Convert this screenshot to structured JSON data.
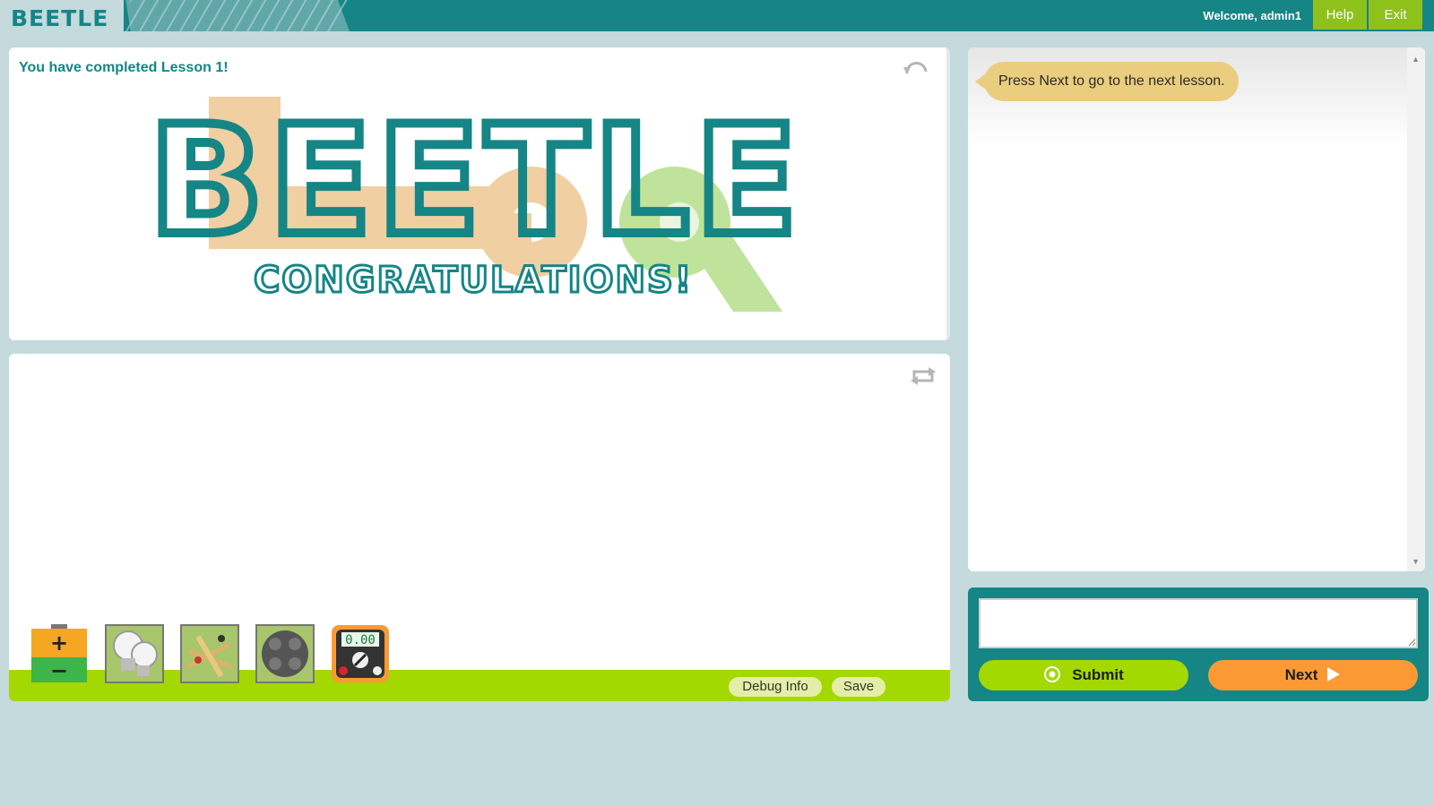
{
  "header": {
    "logo": "BEETLE",
    "welcome": "Welcome, admin1",
    "help_label": "Help",
    "exit_label": "Exit"
  },
  "lesson": {
    "title": "You have completed Lesson 1!",
    "art_logo": "BEETLE",
    "art_caption": "CONGRATULATIONS!"
  },
  "workspace": {
    "meter_reading": "0.00",
    "battery_plus": "+",
    "battery_minus": "−",
    "debug_label": "Debug Info",
    "save_label": "Save",
    "tools": [
      "battery-tool",
      "bulb-tool",
      "wire-tool",
      "switch-tool",
      "multimeter-tool"
    ]
  },
  "chat": {
    "messages": [
      {
        "text": "Press Next to go to the next lesson."
      }
    ]
  },
  "input": {
    "value": "",
    "submit_label": "Submit",
    "next_label": "Next"
  },
  "colors": {
    "brand_teal": "#158586",
    "accent_green": "#a3d800",
    "accent_orange": "#fb9a35",
    "bubble": "#ebcd7f",
    "background": "#c4dadd"
  }
}
